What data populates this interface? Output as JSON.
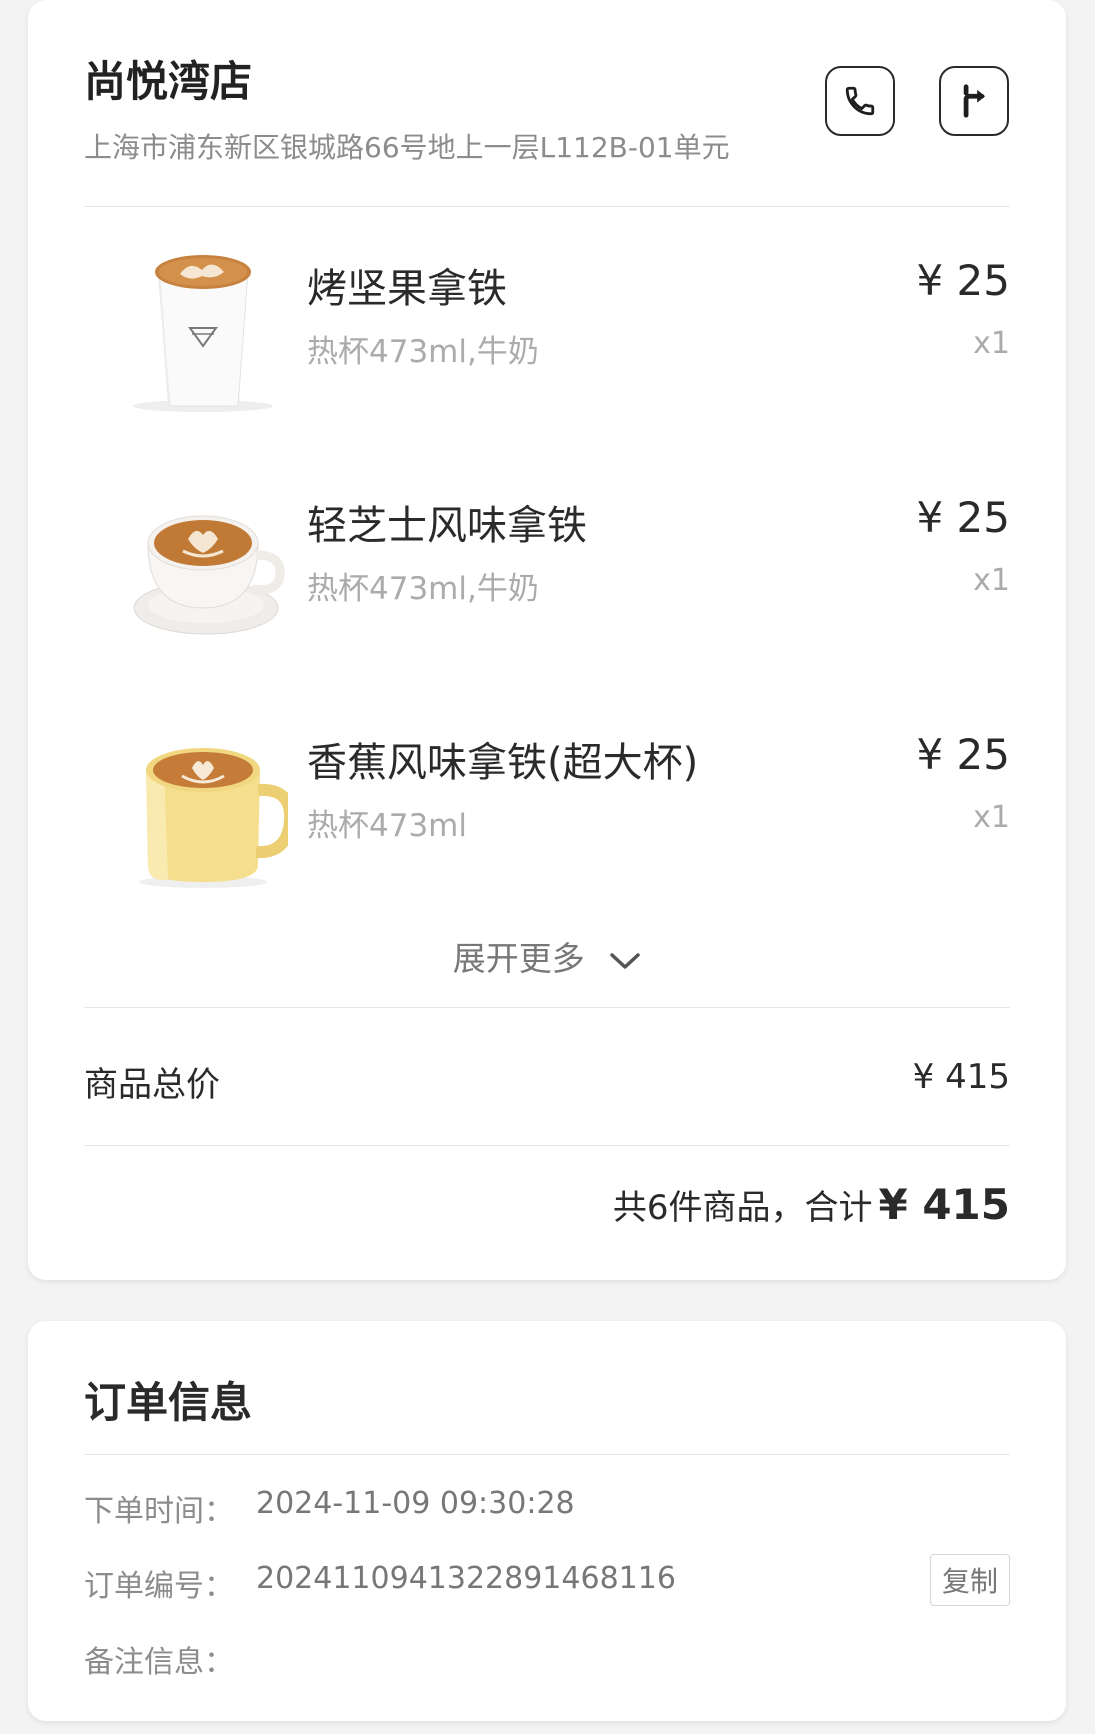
{
  "store": {
    "name": "尚悦湾店",
    "address": "上海市浦东新区银城路66号地上一层L112B-01单元",
    "call_icon": "phone-icon",
    "navigate_icon": "turn-right-arrow-icon"
  },
  "items": [
    {
      "name": "烤坚果拿铁",
      "spec": "热杯473ml,牛奶",
      "price": "¥ 25",
      "qty": "x1",
      "image": "white-paper-cup-latte"
    },
    {
      "name": "轻芝士风味拿铁",
      "spec": "热杯473ml,牛奶",
      "price": "¥ 25",
      "qty": "x1",
      "image": "white-cup-saucer-latte"
    },
    {
      "name": "香蕉风味拿铁(超大杯)",
      "spec": "热杯473ml",
      "price": "¥ 25",
      "qty": "x1",
      "image": "yellow-mug-latte"
    }
  ],
  "expand": {
    "label": "展开更多",
    "icon": "chevron-down-icon"
  },
  "summary": {
    "subtotal_label": "商品总价",
    "subtotal_value": "¥ 415",
    "total_prefix": "共6件商品，合计",
    "total_amount": "¥ 415"
  },
  "order_info": {
    "title": "订单信息",
    "time_label": "下单时间：",
    "time_value": "2024-11-09 09:30:28",
    "number_label": "订单编号：",
    "number_value": "2024110941322891468116",
    "copy_label": "复制",
    "note_label": "备注信息："
  }
}
